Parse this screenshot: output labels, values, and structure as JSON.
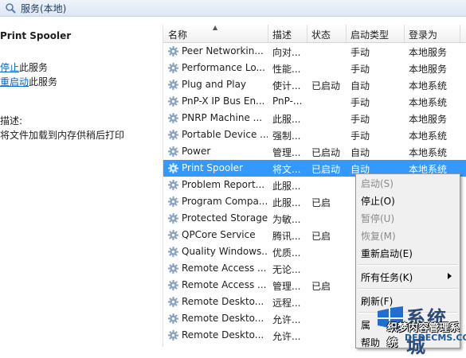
{
  "window": {
    "title": "服务(本地)"
  },
  "detail": {
    "service_name": "Print Spooler",
    "actions": [
      {
        "link": "停止",
        "suffix": "此服务"
      },
      {
        "link": "重启动",
        "suffix": "此服务"
      }
    ],
    "description_label": "描述:",
    "description": "将文件加载到内存供稍后打印"
  },
  "columns": [
    "名称",
    "描述",
    "状态",
    "启动类型",
    "登录为"
  ],
  "services": [
    {
      "name": "Peer Networkin...",
      "desc": "向对...",
      "status": "",
      "startup": "手动",
      "logon": "本地服务"
    },
    {
      "name": "Performance Lo...",
      "desc": "性能...",
      "status": "",
      "startup": "手动",
      "logon": "本地服务"
    },
    {
      "name": "Plug and Play",
      "desc": "使计...",
      "status": "已启动",
      "startup": "自动",
      "logon": "本地系统"
    },
    {
      "name": "PnP-X IP Bus En...",
      "desc": "PnP-...",
      "status": "",
      "startup": "手动",
      "logon": "本地系统"
    },
    {
      "name": "PNRP Machine ...",
      "desc": "此服...",
      "status": "",
      "startup": "手动",
      "logon": "本地服务"
    },
    {
      "name": "Portable Device ...",
      "desc": "强制...",
      "status": "",
      "startup": "手动",
      "logon": "本地系统"
    },
    {
      "name": "Power",
      "desc": "管理...",
      "status": "已启动",
      "startup": "自动",
      "logon": "本地系统"
    },
    {
      "name": "Print Spooler",
      "desc": "将文...",
      "status": "已启动",
      "startup": "自动",
      "logon": "本地系统",
      "selected": true
    },
    {
      "name": "Problem Report...",
      "desc": "此服...",
      "status": "",
      "startup": "",
      "logon": ""
    },
    {
      "name": "Program Compa...",
      "desc": "此服...",
      "status": "已启",
      "startup": "",
      "logon": ""
    },
    {
      "name": "Protected Storage",
      "desc": "为敏...",
      "status": "",
      "startup": "",
      "logon": ""
    },
    {
      "name": "QPCore Service",
      "desc": "腾讯...",
      "status": "已启",
      "startup": "",
      "logon": ""
    },
    {
      "name": "Quality Windows...",
      "desc": "优质...",
      "status": "",
      "startup": "",
      "logon": ""
    },
    {
      "name": "Remote Access ...",
      "desc": "无论...",
      "status": "",
      "startup": "",
      "logon": ""
    },
    {
      "name": "Remote Access ...",
      "desc": "管理...",
      "status": "已启",
      "startup": "",
      "logon": ""
    },
    {
      "name": "Remote Deskto...",
      "desc": "远程...",
      "status": "",
      "startup": "",
      "logon": ""
    },
    {
      "name": "Remote Deskto...",
      "desc": "允许...",
      "status": "",
      "startup": "",
      "logon": ""
    },
    {
      "name": "Remote Deskto...",
      "desc": "允许...",
      "status": "",
      "startup": "",
      "logon": ""
    }
  ],
  "context_menu": {
    "start": "启动(S)",
    "stop": "停止(O)",
    "pause": "暂停(U)",
    "resume": "恢复(M)",
    "restart": "重新启动(E)",
    "all_tasks": "所有任务(K)",
    "refresh": "刷新(F)",
    "properties": "属",
    "help": "帮助"
  },
  "watermark": {
    "line1": "系统城",
    "line2": "织梦内容管理系统",
    "line3": "DEDECMS.COM"
  },
  "colors": {
    "selection": "#3399ff",
    "link": "#0066cc"
  }
}
